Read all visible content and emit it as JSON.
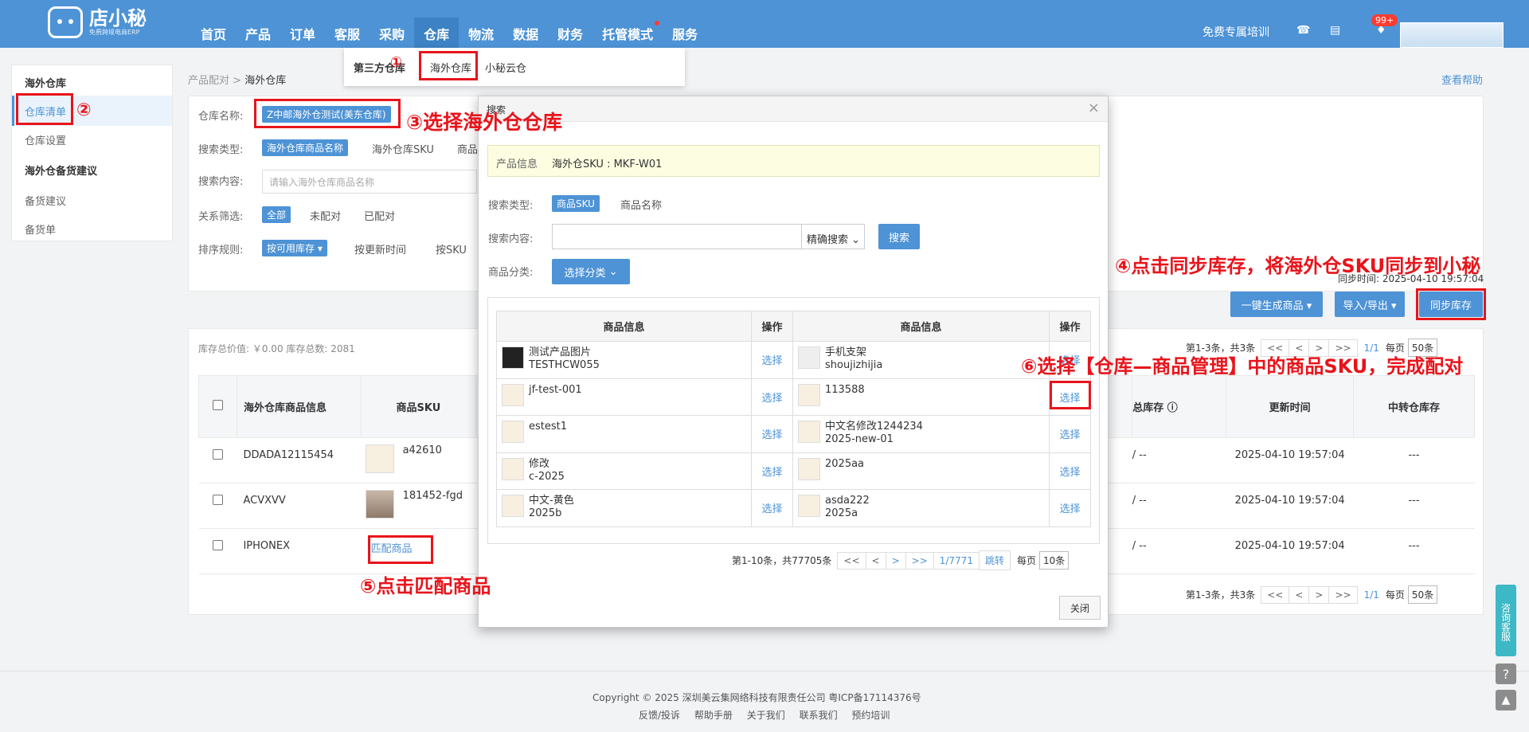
{
  "app": {
    "logo_title": "店小秘",
    "logo_subtitle": "免费跨境电商ERP"
  },
  "nav": {
    "items": [
      "首页",
      "产品",
      "订单",
      "客服",
      "采购",
      "仓库",
      "物流",
      "数据",
      "财务",
      "托管模式",
      "服务"
    ],
    "active": "仓库"
  },
  "topright": {
    "training": "免费专属培训",
    "badge": "99+",
    "icons": [
      "headset-icon",
      "book-icon",
      "bell-icon"
    ]
  },
  "subnav": {
    "label": "第三方仓库",
    "items": [
      "海外仓库",
      "小秘云仓"
    ]
  },
  "sidebar": {
    "groups": [
      {
        "title": "海外仓库",
        "items": [
          "仓库清单",
          "仓库设置"
        ]
      },
      {
        "title": "海外仓备货建议",
        "items": [
          "备货建议",
          "备货单"
        ]
      }
    ],
    "active": "仓库清单"
  },
  "breadcrumb": {
    "parent": "产品配对",
    "sep": ">",
    "current": "海外仓库"
  },
  "help_link": "查看帮助",
  "filter": {
    "warehouse_label": "仓库名称:",
    "warehouse_value": "Z中邮海外仓测试(美东仓库)",
    "search_type_label": "搜索类型:",
    "search_types": [
      "海外仓库商品名称",
      "海外仓库SKU",
      "商品"
    ],
    "search_content_label": "搜索内容:",
    "search_placeholder": "请输入海外仓库商品名称",
    "relation_label": "关系筛选:",
    "relations": [
      "全部",
      "未配对",
      "已配对"
    ],
    "sort_label": "排序规则:",
    "sorts": [
      "按可用库存 ▾",
      "按更新时间",
      "按SKU"
    ]
  },
  "sync_time": "同步时间: 2025-04-10 19:57:04",
  "toolbar": {
    "generate": "一键生成商品 ▾",
    "import_export": "导入/导出 ▾",
    "sync": "同步库存"
  },
  "main": {
    "totals": "库存总价值: ￥0.00 库存总数: 2081",
    "pager": {
      "summary": "第1-3条，共3条",
      "page": "1/1",
      "per_page_label": "每页",
      "per_page": "50条"
    },
    "columns": [
      "海外仓库商品信息",
      "商品SKU",
      "总库存",
      "更新时间",
      "中转仓库存"
    ],
    "rows": [
      {
        "name": "DDADA12115454",
        "sku": "a42610",
        "stock": "/ --",
        "updated": "2025-04-10 19:57:04",
        "transit": "---"
      },
      {
        "name": "ACVXVV",
        "sku": "181452-fgd",
        "stock": "/ --",
        "updated": "2025-04-10 19:57:04",
        "transit": "---"
      },
      {
        "name": "IPHONEX",
        "sku": "匹配商品",
        "stock": "/ --",
        "updated": "2025-04-10 19:57:04",
        "transit": "---"
      }
    ]
  },
  "modal": {
    "title": "搜索",
    "info_label": "产品信息",
    "info_value": "海外仓SKU : MKF-W01",
    "search_type_label": "搜索类型:",
    "search_types": [
      "商品SKU",
      "商品名称"
    ],
    "search_content_label": "搜索内容:",
    "search_mode": "精确搜索",
    "search_button": "搜索",
    "category_label": "商品分类:",
    "category_button": "选择分类",
    "columns": [
      "商品信息",
      "操作",
      "商品信息",
      "操作"
    ],
    "select_label": "选择",
    "rows": [
      {
        "left": [
          "测试产品图片",
          "TESTHCW055"
        ],
        "right": [
          "手机支架",
          "shoujizhijia"
        ]
      },
      {
        "left": [
          "jf-test-001"
        ],
        "right": [
          "113588"
        ]
      },
      {
        "left": [
          "estest1"
        ],
        "right": [
          "中文名修改1244234",
          "2025-new-01"
        ]
      },
      {
        "left": [
          "修改",
          "c-2025"
        ],
        "right": [
          "2025aa"
        ]
      },
      {
        "left": [
          "中文-黄色",
          "2025b"
        ],
        "right": [
          "asda222",
          "2025a"
        ]
      }
    ],
    "pager": {
      "summary": "第1-10条，共77705条",
      "first": "<<",
      "prev": "<",
      "next": ">",
      "last": ">>",
      "page": "1/7771",
      "jump": "跳转",
      "per_page_label": "每页",
      "per_page": "10条"
    },
    "close_button": "关闭"
  },
  "annotations": {
    "a1": "①",
    "a2": "②",
    "a3": "③选择海外仓仓库",
    "a4": "④点击同步库存，将海外仓SKU同步到小秘",
    "a5": "⑤点击匹配商品",
    "a6": "⑥选择【仓库—商品管理】中的商品SKU，完成配对"
  },
  "side_float": {
    "consult": "咨询客服"
  },
  "footer": {
    "copyright": "Copyright © 2025 深圳美云集网络科技有限责任公司  粤ICP备17114376号",
    "links": [
      "反馈/投诉",
      "帮助手册",
      "关于我们",
      "联系我们",
      "预约培训"
    ]
  },
  "colors": {
    "primary": "#4d93d6",
    "annotation": "#e8141b"
  }
}
